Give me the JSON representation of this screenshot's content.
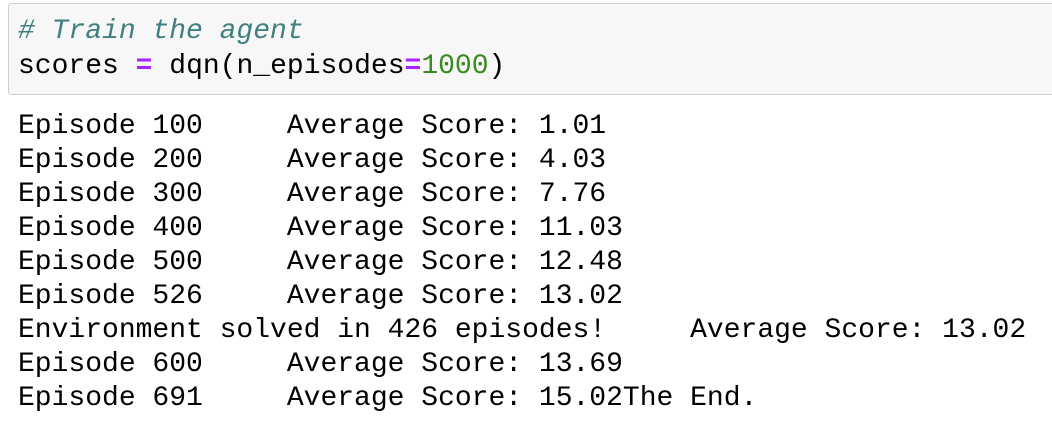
{
  "input": {
    "comment": "# Train the agent",
    "var": "scores",
    "op": "=",
    "call": "dqn(n_episodes",
    "eq": "=",
    "arg": "1000",
    "close": ")"
  },
  "output": {
    "lines": [
      "Episode 100     Average Score: 1.01",
      "Episode 200     Average Score: 4.03",
      "Episode 300     Average Score: 7.76",
      "Episode 400     Average Score: 11.03",
      "Episode 500     Average Score: 12.48",
      "Episode 526     Average Score: 13.02",
      "Environment solved in 426 episodes!     Average Score: 13.02",
      "Episode 600     Average Score: 13.69",
      "Episode 691     Average Score: 15.02The End."
    ]
  }
}
